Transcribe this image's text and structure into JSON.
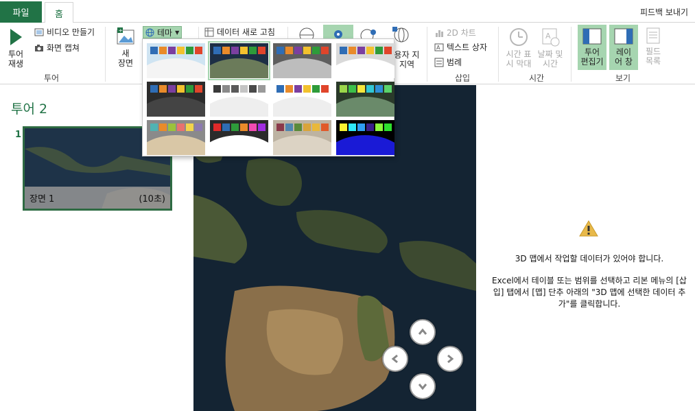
{
  "tabs": {
    "file": "파일",
    "home": "홈",
    "feedback": "피드백 보내기"
  },
  "ribbon": {
    "play_tour": "투어\n재생",
    "create_video": "비디오 만들기",
    "capture_screen": "화면 캡쳐",
    "group_tour": "투어",
    "new_scene": "새\n장면",
    "themes": "테마",
    "refresh_data": "데이터 새로 고침",
    "custom_regions": "용자 지\n 지역",
    "chart_2d": "2D 차트",
    "text_box": "텍스트 상자",
    "legend": "범례",
    "group_insert": "삽입",
    "timeline": "시간 표\n시 막대",
    "date_time": "날짜 및\n시간",
    "group_time": "시간",
    "tour_editor": "투어\n편집기",
    "layer_pane": "레이\n어 창",
    "field_list": "필드\n목록",
    "group_view": "보기"
  },
  "themes": [
    {
      "colors": [
        "#2f6db5",
        "#e98b2a",
        "#7b3fa0",
        "#f2c12e",
        "#2e9b3a",
        "#e0452b"
      ],
      "style": "light"
    },
    {
      "colors": [
        "#2f6db5",
        "#e98b2a",
        "#7b3fa0",
        "#f2c12e",
        "#2e9b3a",
        "#e0452b"
      ],
      "style": "aerial"
    },
    {
      "colors": [
        "#2f6db5",
        "#e98b2a",
        "#7b3fa0",
        "#f2c12e",
        "#2e9b3a",
        "#e0452b"
      ],
      "style": "gray"
    },
    {
      "colors": [
        "#2f6db5",
        "#e98b2a",
        "#7b3fa0",
        "#f2c12e",
        "#2e9b3a",
        "#e0452b"
      ],
      "style": "silver"
    },
    {
      "colors": [
        "#2f6db5",
        "#e98b2a",
        "#7b3fa0",
        "#f2c12e",
        "#2e9b3a",
        "#e0452b"
      ],
      "style": "dark"
    },
    {
      "colors": [
        "#3a3a3a",
        "#8a8a8a",
        "#5a5a5a",
        "#c4c4c4",
        "#4a4a4a",
        "#9a9a9a"
      ],
      "style": "white"
    },
    {
      "colors": [
        "#2f6db5",
        "#e98b2a",
        "#7b3fa0",
        "#f2c12e",
        "#2e9b3a",
        "#e0452b"
      ],
      "style": "white"
    },
    {
      "colors": [
        "#9bd64a",
        "#3cc04a",
        "#f6e73c",
        "#31c7d4",
        "#2e8fd6",
        "#5bd46a"
      ],
      "style": "greenDark"
    },
    {
      "colors": [
        "#4fb3b3",
        "#e98b2a",
        "#9bc23c",
        "#e8716f",
        "#f2d34b",
        "#8c7ab0"
      ],
      "style": "sepia"
    },
    {
      "colors": [
        "#e02a2a",
        "#2f6db5",
        "#2e9b3a",
        "#e98b2a",
        "#f24bb2",
        "#a02de0"
      ],
      "style": "darkWhite"
    },
    {
      "colors": [
        "#8b3a4a",
        "#4f86b0",
        "#5a8a3a",
        "#d9a43a",
        "#e9b83a",
        "#e05a2a"
      ],
      "style": "beige"
    },
    {
      "colors": [
        "#f9f231",
        "#2fe9f9",
        "#2f9df2",
        "#3a1f8a",
        "#8bf93a",
        "#2ee02e"
      ],
      "style": "blue"
    }
  ],
  "left": {
    "tour_title": "투어 2",
    "scene_number": "1",
    "scene_name": "장면 1",
    "scene_duration": "(10초)"
  },
  "message": {
    "line1": "3D 맵에서 작업할 데이터가 있어야 합니다.",
    "line2": "Excel에서 테이블 또는 범위를 선택하고 리본 메뉴의 [삽입] 탭에서 [맵] 단추 아래의 \"3D 맵에 선택한 데이터 추가\"를 클릭합니다."
  },
  "colors": {
    "accent": "#217346",
    "selected": "#a6d5b0"
  }
}
